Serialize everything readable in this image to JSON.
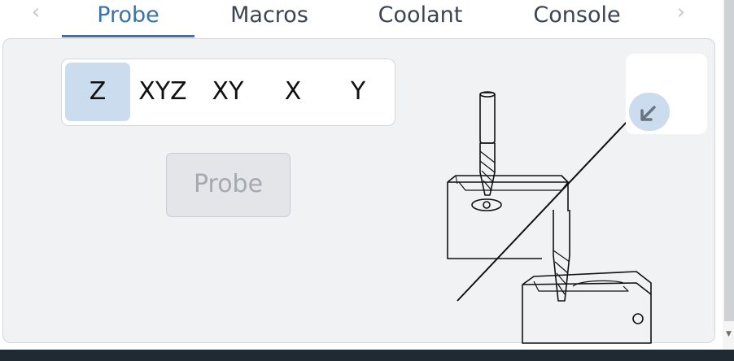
{
  "tabs": {
    "items": [
      {
        "label": "Probe",
        "active": true
      },
      {
        "label": "Macros",
        "active": false
      },
      {
        "label": "Coolant",
        "active": false
      },
      {
        "label": "Console",
        "active": false
      }
    ],
    "prev_icon": "chevron-left-icon",
    "next_icon": "chevron-right-icon"
  },
  "probe": {
    "axis_options": [
      "Z",
      "XYZ",
      "XY",
      "X",
      "Y"
    ],
    "selected_axis": "Z",
    "button_label": "Probe",
    "button_disabled": true
  },
  "side_card": {
    "collapse_icon": "arrow-down-left-icon"
  },
  "colors": {
    "accent": "#3a72ad",
    "selected_bg": "#cbdcee",
    "panel_bg": "#f1f2f4",
    "bottom_bar": "#1f2a33"
  }
}
